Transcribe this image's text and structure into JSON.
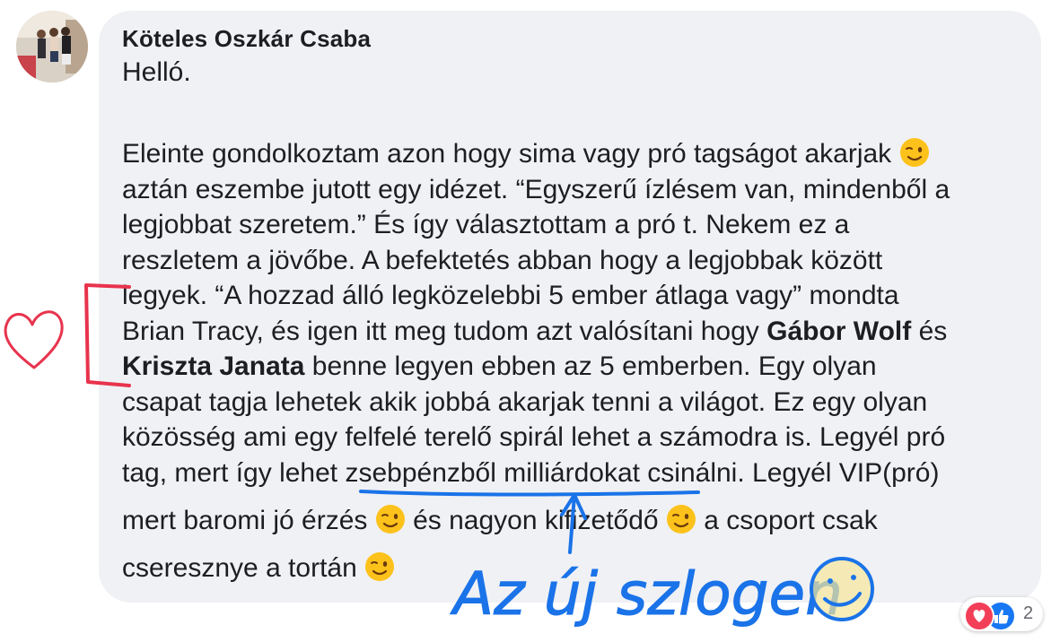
{
  "comment": {
    "author": "Köteles Oszkár Csaba",
    "greeting": "Helló.",
    "lines": [
      {
        "parts": [
          {
            "t": "Eleinte gondolkoztam azon hogy sima vagy pró tagságot akarjak "
          },
          {
            "emoji": "wink"
          }
        ]
      },
      {
        "parts": [
          {
            "t": "aztán eszembe jutott egy idézet. “Egyszerű ízlésem van, mindenből a"
          }
        ]
      },
      {
        "parts": [
          {
            "t": "legjobbat szeretem.” És így választottam a pró t. Nekem ez a"
          }
        ]
      },
      {
        "parts": [
          {
            "t": "reszletem a jövőbe. A befektetés abban hogy a legjobbak között"
          }
        ]
      },
      {
        "parts": [
          {
            "t": "legyek. “A hozzad álló legközelebbi 5 ember átlaga vagy” mondta"
          }
        ]
      },
      {
        "parts": [
          {
            "t": "Brian Tracy, és igen itt meg tudom azt valósítani hogy "
          },
          {
            "b": "Gábor Wolf"
          },
          {
            "t": " és"
          }
        ]
      },
      {
        "parts": [
          {
            "b": "Kriszta Janata"
          },
          {
            "t": " benne legyen ebben az 5 emberben. Egy olyan"
          }
        ]
      },
      {
        "parts": [
          {
            "t": "csapat tagja lehetek akik jobbá akarjak tenni a világot. Ez egy olyan"
          }
        ]
      },
      {
        "parts": [
          {
            "t": "közösség ami egy felfelé terelő spirál lehet a számodra is. Legyél pró"
          }
        ]
      },
      {
        "tall": true,
        "parts": [
          {
            "t": "tag, mert így lehet zsebpénzből milliárdokat csinálni. Legyél VIP(pró)"
          }
        ]
      },
      {
        "tall": true,
        "parts": [
          {
            "t": "mert baromi jó érzés "
          },
          {
            "emoji": "wink"
          },
          {
            "t": " és nagyon kifizetődő "
          },
          {
            "emoji": "wink"
          },
          {
            "t": " a csoport csak"
          }
        ]
      },
      {
        "tall": true,
        "parts": [
          {
            "t": "cseresznye a tortán "
          },
          {
            "emoji": "wink"
          }
        ]
      }
    ]
  },
  "reactions": {
    "types": [
      "love",
      "like"
    ],
    "count": "2"
  },
  "annotation": {
    "handwritten_text": "Az új szlogen",
    "ink_color": "#1a73e8",
    "heart_color": "#e8334d"
  },
  "colors": {
    "bubble": "#f0f1f4",
    "text": "#1c1e21",
    "love": "#f33e58",
    "like": "#1877f2"
  }
}
